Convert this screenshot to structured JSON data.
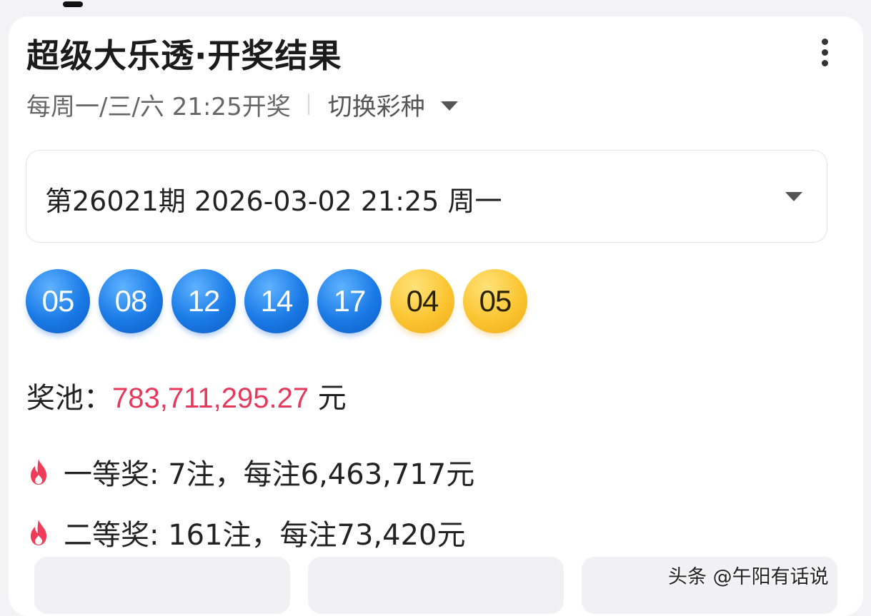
{
  "header": {
    "title": "超级大乐透·开奖结果",
    "schedule": "每周一/三/六 21:25开奖",
    "switch_label": "切换彩种"
  },
  "issue": {
    "label": "第26021期 2026-03-02 21:25 周一"
  },
  "balls": {
    "front": [
      "05",
      "08",
      "12",
      "14",
      "17"
    ],
    "back": [
      "04",
      "05"
    ]
  },
  "pool": {
    "label": "奖池：",
    "amount": "783,711,295.27",
    "unit": "元"
  },
  "prizes": [
    {
      "text": "一等奖: 7注，每注6,463,717元"
    },
    {
      "text": "二等奖: 161注，每注73,420元"
    }
  ],
  "watermark": "头条 @午阳有话说",
  "colors": {
    "front_ball": "#1a7ae6",
    "back_ball": "#fbc531",
    "pool_amount": "#e5385a",
    "fire_icon": "#f03c58"
  }
}
